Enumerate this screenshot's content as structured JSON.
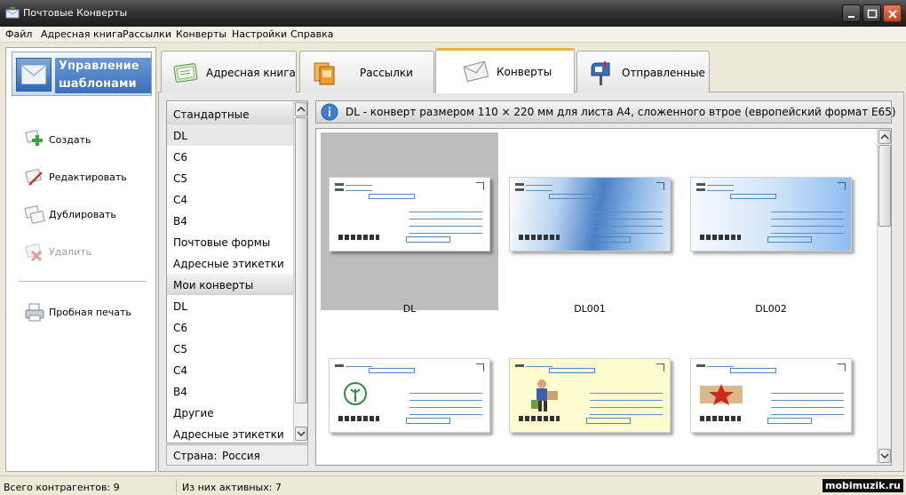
{
  "window": {
    "title": "Почтовые Конверты"
  },
  "menu": [
    "Файл",
    "Адресная книга",
    "Рассылки",
    "Конверты",
    "Настройки",
    "Справка"
  ],
  "sidebar": {
    "header": "Управление шаблонами",
    "actions": [
      {
        "label": "Создать",
        "icon": "create-icon",
        "enabled": true
      },
      {
        "label": "Редактировать",
        "icon": "edit-icon",
        "enabled": true
      },
      {
        "label": "Дублировать",
        "icon": "duplicate-icon",
        "enabled": true
      },
      {
        "label": "Удалить",
        "icon": "delete-icon",
        "enabled": false
      }
    ],
    "print_label": "Пробная печать"
  },
  "tabs": [
    {
      "label": "Адресная книга",
      "icon": "address-book-icon",
      "active": false
    },
    {
      "label": "Рассылки",
      "icon": "mailings-icon",
      "active": false
    },
    {
      "label": "Конверты",
      "icon": "envelope-icon",
      "active": true
    },
    {
      "label": "Отправленные",
      "icon": "mailbox-icon",
      "active": false
    }
  ],
  "categories": [
    {
      "label": "Стандартные",
      "group": true
    },
    {
      "label": "DL",
      "selected": true
    },
    {
      "label": "C6"
    },
    {
      "label": "C5"
    },
    {
      "label": "C4"
    },
    {
      "label": "B4"
    },
    {
      "label": "Почтовые формы"
    },
    {
      "label": "Адресные этикетки"
    },
    {
      "label": "Мои конверты",
      "group": true
    },
    {
      "label": "DL"
    },
    {
      "label": "C6"
    },
    {
      "label": "C5"
    },
    {
      "label": "C4"
    },
    {
      "label": "B4"
    },
    {
      "label": "Другие"
    },
    {
      "label": "Адресные этикетки"
    }
  ],
  "country": {
    "label": "Страна:",
    "value": "Россия"
  },
  "info": "DL - конверт размером 110 × 220 мм для листа А4, сложенного втрое (европейский формат E65)",
  "templates": [
    {
      "name": "DL",
      "style": "plain",
      "selected": true
    },
    {
      "name": "DL001",
      "style": "blue1"
    },
    {
      "name": "DL002",
      "style": "blue2"
    },
    {
      "name": "",
      "style": "pharmacy"
    },
    {
      "name": "",
      "style": "cream"
    },
    {
      "name": "",
      "style": "victory"
    }
  ],
  "status": {
    "total": "Всего контрагентов: 9",
    "active": "Из них активных: 7"
  },
  "watermark": "mobimuzik.ru",
  "colors": {
    "accent_tab": "#f0b13c",
    "header_blue": "#3a71bb"
  }
}
